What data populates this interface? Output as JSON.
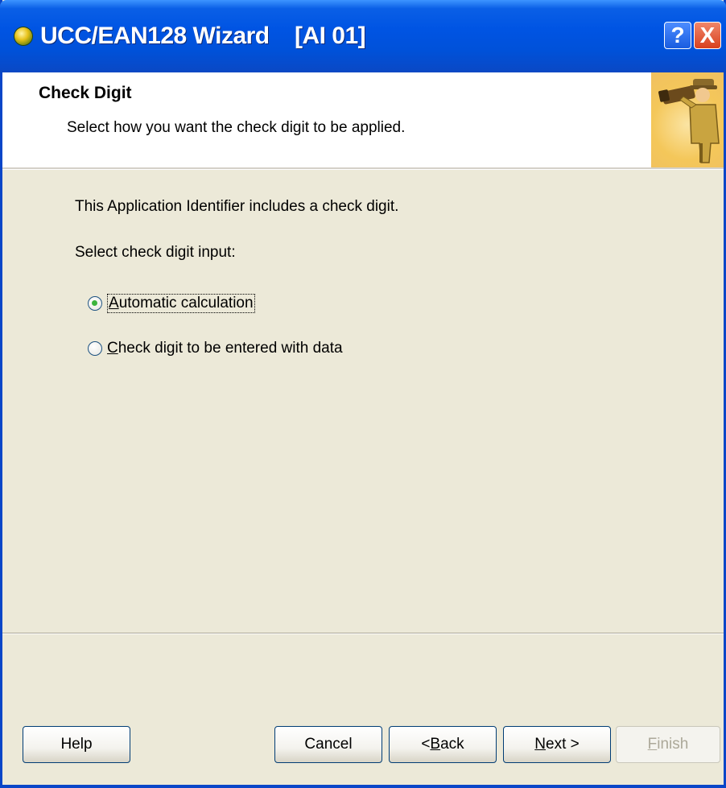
{
  "window": {
    "title": "UCC/EAN128 Wizard    [AI 01]",
    "help_button": "?",
    "close_button": "X"
  },
  "header": {
    "title": "Check Digit",
    "subtitle": "Select how you want the check digit to be applied."
  },
  "content": {
    "info": "This Application Identifier includes a check digit.",
    "prompt": "Select check digit input:",
    "options": [
      {
        "pre": "",
        "key": "A",
        "rest": "utomatic calculation",
        "checked": true
      },
      {
        "pre": "",
        "key": "C",
        "rest": "heck digit to be entered with data",
        "checked": false
      }
    ]
  },
  "buttons": {
    "help": "Help",
    "cancel": "Cancel",
    "back_prefix": "< ",
    "back_key": "B",
    "back_rest": "ack",
    "next_key": "N",
    "next_rest": "ext >",
    "finish_key": "F",
    "finish_rest": "inish",
    "finish_enabled": false
  },
  "colors": {
    "titlebar": "#0054e3",
    "dialog_bg": "#ece9d8",
    "radio_dot": "#3cb43c"
  },
  "icons": [
    "wizard-app-icon",
    "help-icon",
    "close-icon",
    "telescope-man-icon"
  ]
}
